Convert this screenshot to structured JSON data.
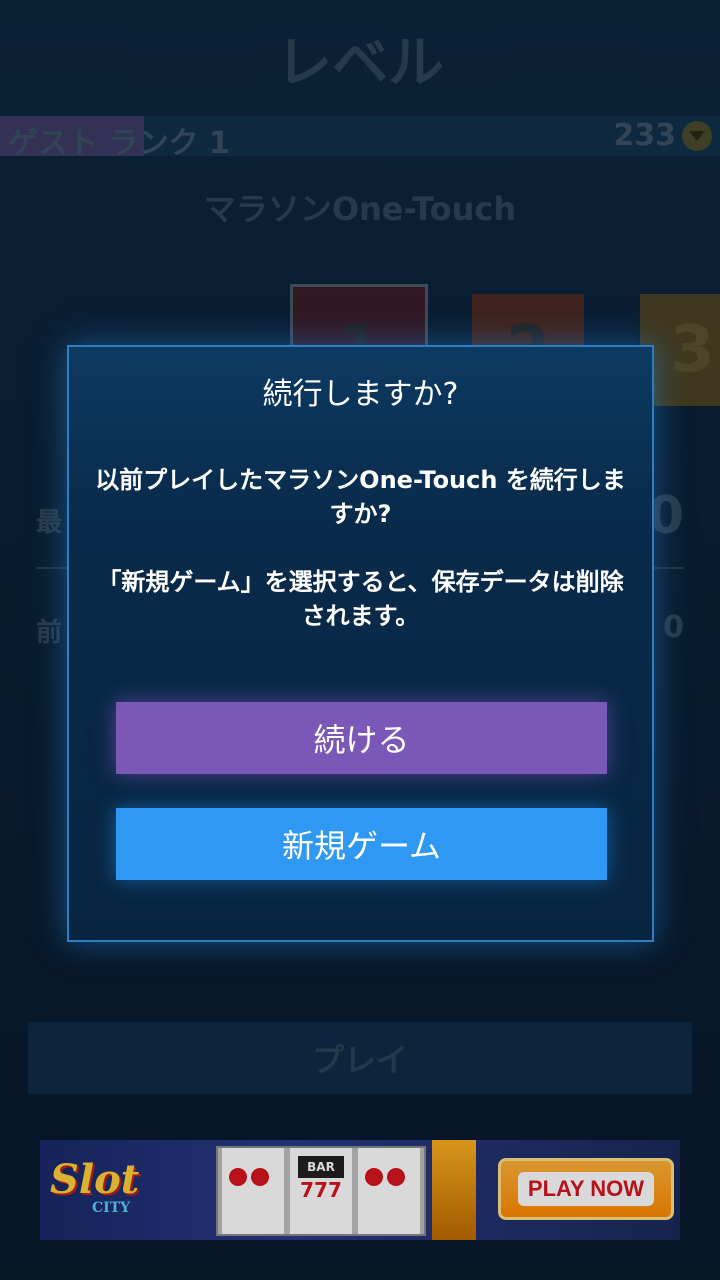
{
  "screen": {
    "title": "レベル",
    "rank_label": "ゲスト ランク 1",
    "rank_progress": 0.2,
    "coins": "233",
    "mode_name": "マラソンOne-Touch",
    "levels": [
      "1",
      "2",
      "3"
    ],
    "stats": [
      {
        "label": "最",
        "value": "0"
      },
      {
        "label": "前",
        "value": "0"
      }
    ],
    "play_label": "プレイ"
  },
  "ad": {
    "logo_main": "Slot",
    "logo_sub": "CITY",
    "reel_bar": "BAR",
    "reel_sevens": "777",
    "cta": "PLAY NOW"
  },
  "dialog": {
    "title": "続行しますか?",
    "message_1": "以前プレイしたマラソンOne-Touch を続行しますか?",
    "message_2": "「新規ゲーム」を選択すると、保存データは削除されます。",
    "continue_label": "続ける",
    "new_game_label": "新規ゲーム"
  },
  "colors": {
    "continue": "#7b57b8",
    "new_game": "#2e98f2",
    "dialog_border": "#2d7fc2"
  },
  "icons": [
    "coin-icon"
  ]
}
